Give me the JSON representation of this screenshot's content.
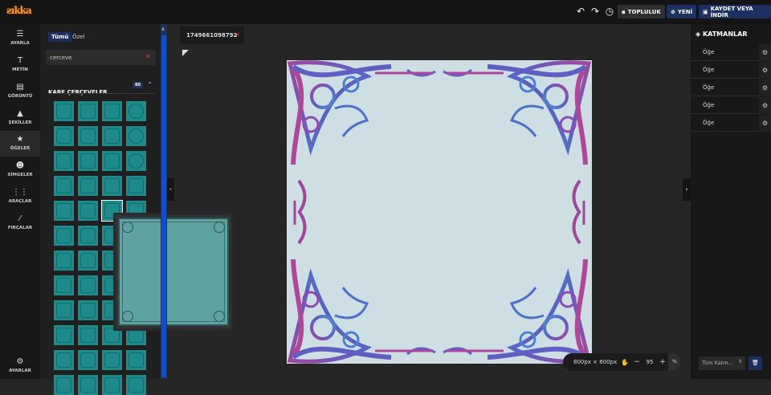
{
  "topbar": {
    "logo": "ƨıkka",
    "undo_icon": "undo-icon",
    "redo_icon": "redo-icon",
    "history_icon": "history-icon",
    "community_label": "TOPLULUK",
    "new_label": "YENİ",
    "save_label": "KAYDET VEYA İNDİR"
  },
  "iconbar": {
    "items": [
      {
        "label": "AYARLA",
        "icon": "sliders-icon"
      },
      {
        "label": "METİN",
        "icon": "text-icon"
      },
      {
        "label": "GÖRÜNTÜ",
        "icon": "image-icon"
      },
      {
        "label": "ŞEKİLLER",
        "icon": "shapes-icon"
      },
      {
        "label": "ÖĞELER",
        "icon": "star-icon"
      },
      {
        "label": "SİMGELER",
        "icon": "smiley-icon"
      },
      {
        "label": "ARAÇLAR",
        "icon": "grid-icon"
      },
      {
        "label": "FIRÇALAR",
        "icon": "brush-icon"
      }
    ],
    "settings_label": "AYARLAR"
  },
  "panel": {
    "tab_all": "Tümü",
    "tab_custom": "Özel",
    "search_value": "cerceve",
    "section_title": "KARE ÇERÇEVELER",
    "section_count": "80"
  },
  "document": {
    "tab_name": "1749661098792"
  },
  "zoom": {
    "size_label": "800px × 800px",
    "value": "95",
    "minus": "−",
    "plus": "+",
    "unit": "%"
  },
  "layers": {
    "title": "KATMANLAR",
    "rows": [
      "Öğe",
      "Öğe",
      "Öğe",
      "Öğe",
      "Öğe"
    ],
    "select_value": "Tüm Katm..."
  },
  "colors": {
    "accent": "#1d3161",
    "scroll": "#0f4fcf",
    "frame_teal": "#1b8b8b"
  }
}
